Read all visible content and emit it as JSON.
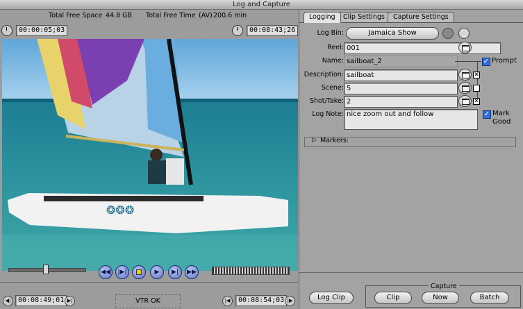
{
  "window": {
    "title": "Log and Capture"
  },
  "status": {
    "free_space_label": "Total Free Space",
    "free_space_value": "44.8 GB",
    "free_time_label": "Total Free Time",
    "free_time_mode": "(AV)",
    "free_time_value": "200.6 min"
  },
  "timecodes": {
    "duration": "00:00:05;03",
    "current_top": "00:08:43;26",
    "in_point": "00:08:49;01",
    "out_point": "00:08:54;03"
  },
  "transport": {
    "vtr_status": "VTR OK",
    "buttons": [
      "rewind",
      "play-in-to-out",
      "stop",
      "play",
      "play-around-current",
      "fast-forward"
    ]
  },
  "tabs": [
    {
      "label": "Logging",
      "active": true
    },
    {
      "label": "Clip Settings",
      "active": false
    },
    {
      "label": "Capture Settings",
      "active": false
    }
  ],
  "logging": {
    "log_bin_label": "Log Bin:",
    "log_bin_value": "Jamaica Show",
    "reel_label": "Reel:",
    "reel_value": "001",
    "name_label": "Name:",
    "name_value": "sailboat_2",
    "prompt_label": "Prompt",
    "description_label": "Description:",
    "description_value": "sailboat",
    "scene_label": "Scene:",
    "scene_value": "5",
    "shot_label": "Shot/Take:",
    "shot_value": "2",
    "log_note_label": "Log Note:",
    "log_note_value": "nice zoom out and follow",
    "mark_good_label_1": "Mark",
    "mark_good_label_2": "Good",
    "markers_label": "Markers:"
  },
  "actions": {
    "log_clip": "Log Clip",
    "capture_group": "Capture",
    "clip": "Clip",
    "now": "Now",
    "batch": "Batch"
  },
  "icons": {
    "clock": "clock-icon",
    "slate": "clapper-slate-icon",
    "folder": "folder-icon",
    "disclosure": "disclosure-triangle-icon"
  },
  "colors": {
    "accent_blue": "#2f6fe0",
    "panel_gray": "#a3a3a3"
  }
}
